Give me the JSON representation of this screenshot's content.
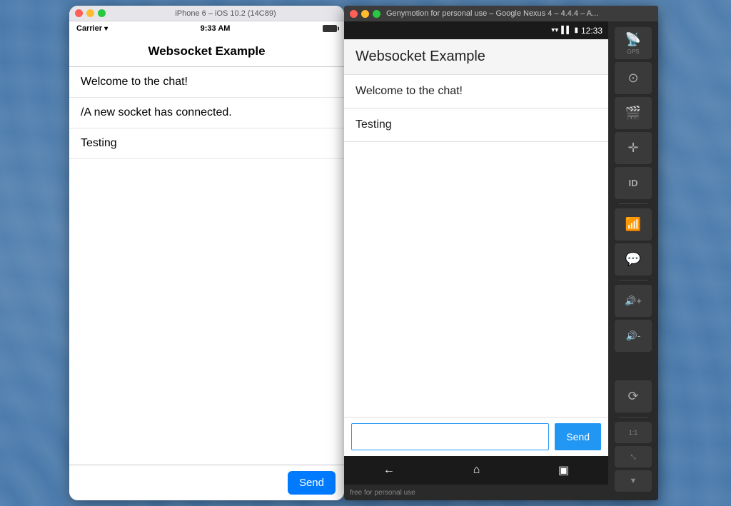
{
  "ios": {
    "title_bar_text": "iPhone 6 – iOS 10.2 (14C89)",
    "status_bar": {
      "carrier": "Carrier",
      "time": "9:33 AM"
    },
    "nav_title": "Websocket Example",
    "messages": [
      {
        "text": "Welcome to the chat!"
      },
      {
        "text": "/A new socket has connected."
      },
      {
        "text": "Testing"
      }
    ],
    "send_button_label": "Send"
  },
  "android": {
    "title_bar_text": "Genymotion for personal use – Google Nexus 4 – 4.4.4 – A...",
    "status_bar": {
      "time": "12:33"
    },
    "action_title": "Websocket Example",
    "messages": [
      {
        "text": "Welcome to the chat!"
      },
      {
        "text": "Testing"
      }
    ],
    "send_button_label": "Send",
    "bottom_text": "free for personal use",
    "toolbar": {
      "buttons": [
        {
          "icon": "📡",
          "label": "GPS"
        },
        {
          "icon": "⊙",
          "label": ""
        },
        {
          "icon": "🎬",
          "label": ""
        },
        {
          "icon": "✛",
          "label": ""
        },
        {
          "icon": "ID",
          "label": ""
        },
        {
          "icon": "📶",
          "label": ""
        },
        {
          "icon": "💬",
          "label": ""
        }
      ],
      "volume_up": "🔊+",
      "volume_down": "🔊-",
      "rotate": "⟳"
    }
  }
}
